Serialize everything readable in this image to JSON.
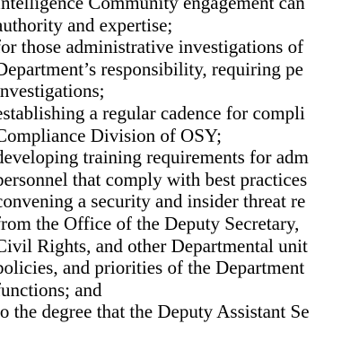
{
  "document": {
    "lines": [
      "Intelligence Community engagement can",
      "authority and expertise;",
      "for those administrative investigations of",
      "Department’s responsibility, requiring pe",
      "investigations;",
      "establishing a regular cadence for compli",
      "Compliance Division of OSY;",
      "developing training requirements for adm",
      "personnel that comply with best practices",
      "convening a security and insider threat re",
      "from the Office of the Deputy Secretary,",
      "Civil Rights, and other Departmental unit",
      "policies, and priorities of the Department",
      "functions; and",
      "to the degree that the Deputy Assistant Se"
    ]
  }
}
